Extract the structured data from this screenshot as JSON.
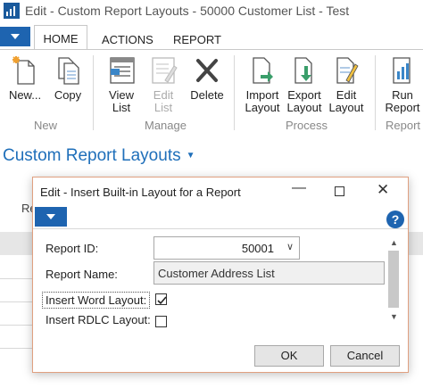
{
  "window": {
    "title": "Edit - Custom Report Layouts - 50000 Customer List - Test"
  },
  "ribbon_tabs": {
    "home": "HOME",
    "actions": "ACTIONS",
    "report": "REPORT"
  },
  "ribbon": {
    "new": "New...",
    "copy": "Copy",
    "view_list_1": "View",
    "view_list_2": "List",
    "edit_list_1": "Edit",
    "edit_list_2": "List",
    "delete": "Delete",
    "import_1": "Import",
    "import_2": "Layout",
    "export_1": "Export",
    "export_2": "Layout",
    "edit_layout_1": "Edit",
    "edit_layout_2": "Layout",
    "run_1": "Run",
    "run_2": "Report",
    "groups": {
      "new": "New",
      "manage": "Manage",
      "process": "Process",
      "report": "Report"
    }
  },
  "page": {
    "title": "Custom Report Layouts",
    "list_header_fragment": "Re"
  },
  "dialog": {
    "title": "Edit - Insert Built-in Layout for a Report",
    "help": "?",
    "fields": {
      "report_id_label": "Report ID:",
      "report_id_value": "50001",
      "report_name_label": "Report Name:",
      "report_name_value": "Customer Address List",
      "insert_word_label": "Insert Word Layout:",
      "insert_word_checked": true,
      "insert_rdlc_label": "Insert RDLC Layout:",
      "insert_rdlc_checked": false
    },
    "ok_label": "OK",
    "cancel_label": "Cancel"
  },
  "colors": {
    "accent": "#1e64b0",
    "title_blue": "#1f6fba",
    "dialog_border": "#e0a080"
  }
}
